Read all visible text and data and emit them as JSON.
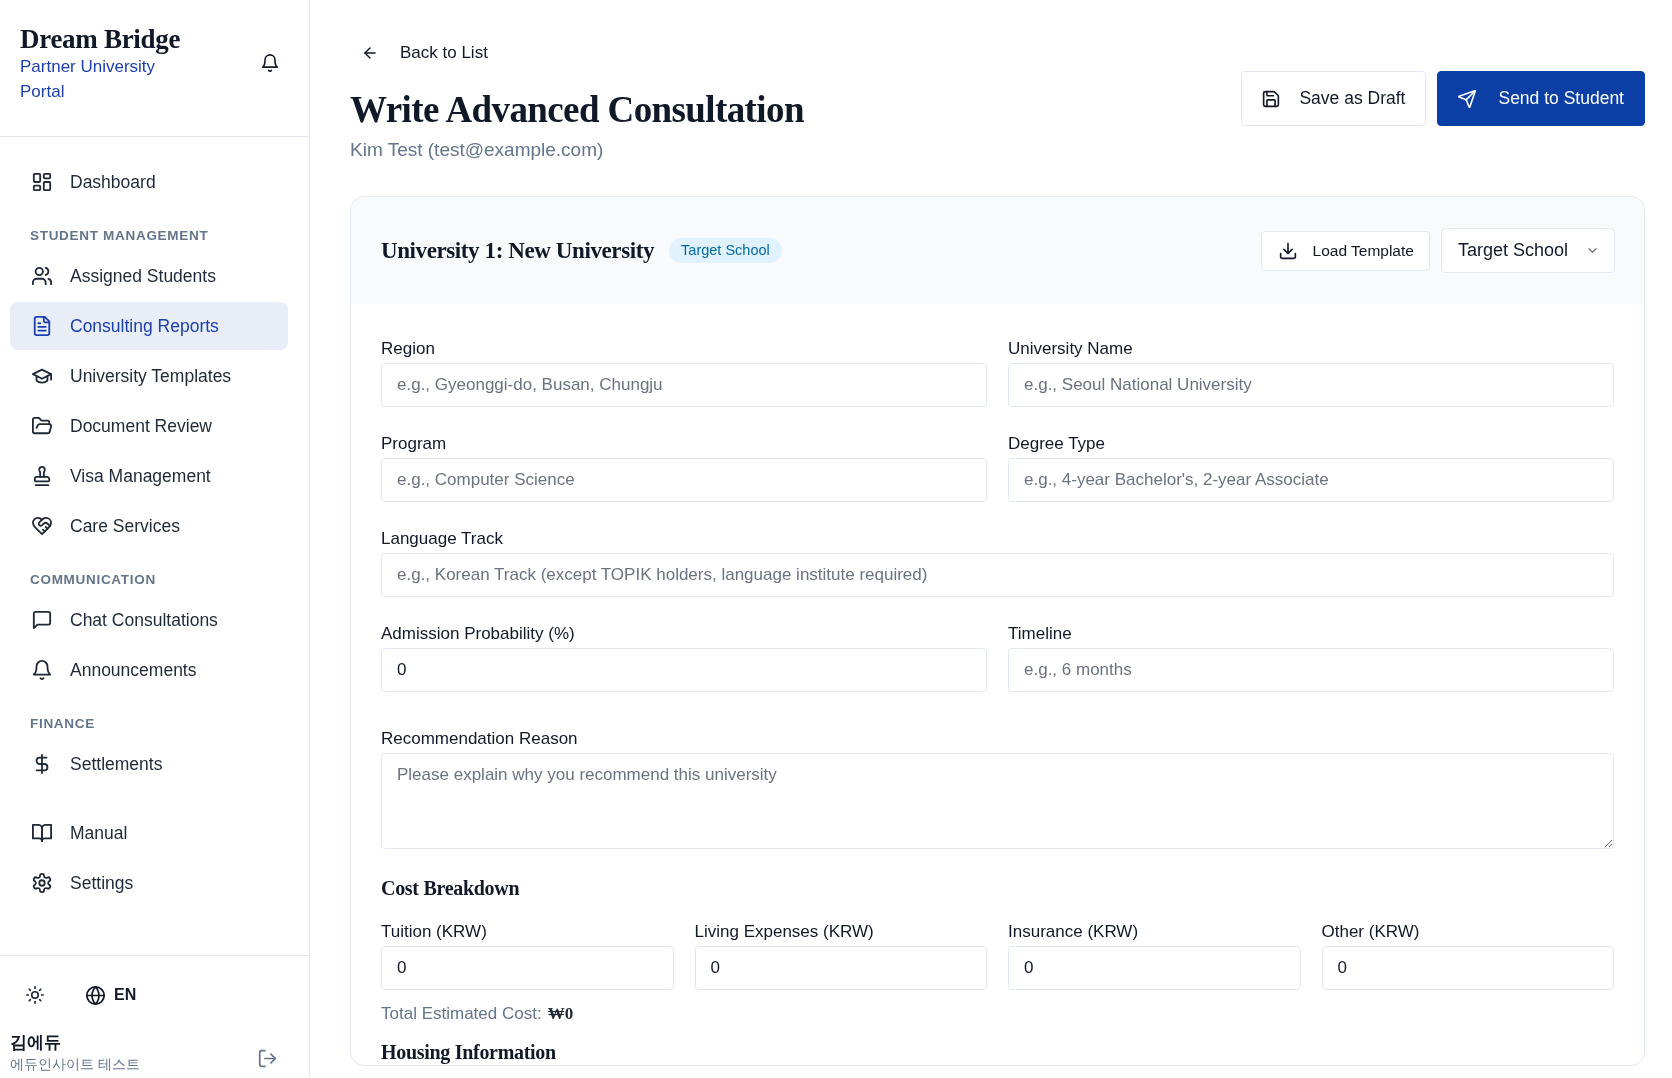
{
  "sidebar": {
    "brand": {
      "title": "Dream Bridge",
      "subtitle": "Partner University Portal"
    },
    "sections": [
      {
        "items": [
          {
            "label": "Dashboard",
            "selected": false
          }
        ]
      },
      {
        "heading": "STUDENT MANAGEMENT",
        "items": [
          {
            "label": "Assigned Students",
            "selected": false
          },
          {
            "label": "Consulting Reports",
            "selected": true
          },
          {
            "label": "University Templates",
            "selected": false
          },
          {
            "label": "Document Review",
            "selected": false
          },
          {
            "label": "Visa Management",
            "selected": false
          },
          {
            "label": "Care Services",
            "selected": false
          }
        ]
      },
      {
        "heading": "COMMUNICATION",
        "items": [
          {
            "label": "Chat Consultations",
            "selected": false
          },
          {
            "label": "Announcements",
            "selected": false
          }
        ]
      },
      {
        "heading": "FINANCE",
        "items": [
          {
            "label": "Settlements",
            "selected": false
          }
        ]
      },
      {
        "items": [
          {
            "label": "Manual",
            "selected": false
          },
          {
            "label": "Settings",
            "selected": false
          }
        ]
      }
    ],
    "footer": {
      "language": "EN",
      "user": {
        "name": "김에듀",
        "organization": "에듀인사이트 테스트"
      }
    }
  },
  "header": {
    "back_link": "Back to List",
    "title": "Write Advanced Consultation",
    "subtitle": "Kim Test (test@example.com)",
    "actions": [
      {
        "label": "Save as Draft",
        "kind": "secondary"
      },
      {
        "label": "Send to Student",
        "kind": "primary"
      }
    ]
  },
  "university_card": {
    "title": "University 1: New University",
    "badge": "Target School",
    "load_template": "Load Template",
    "school_type": {
      "value": "Target School"
    },
    "rows": [
      {
        "fields": [
          {
            "kind": "input",
            "label": "Region",
            "placeholder": "e.g., Gyeonggi-do, Busan, Chungju"
          },
          {
            "kind": "input",
            "label": "University Name",
            "placeholder": "e.g., Seoul National University"
          }
        ]
      },
      {
        "fields": [
          {
            "kind": "input",
            "label": "Program",
            "placeholder": "e.g., Computer Science"
          },
          {
            "kind": "input",
            "label": "Degree Type",
            "placeholder": "e.g., 4-year Bachelor's, 2-year Associate"
          }
        ]
      },
      {
        "fields": [
          {
            "kind": "input",
            "label": "Language Track",
            "placeholder": "e.g., Korean Track (except TOPIK holders, language institute required)"
          }
        ]
      },
      {
        "fields": [
          {
            "kind": "input",
            "label": "Admission Probability (%)",
            "value": "0"
          },
          {
            "kind": "input",
            "label": "Timeline",
            "placeholder": "e.g., 6 months"
          }
        ]
      },
      {
        "fields": [
          {
            "kind": "textarea",
            "label": "Recommendation Reason",
            "placeholder": "Please explain why you recommend this university"
          }
        ]
      }
    ],
    "cost_breakdown": {
      "heading": "Cost Breakdown",
      "fields": [
        {
          "label": "Tuition (KRW)",
          "value": "0"
        },
        {
          "label": "Living Expenses (KRW)",
          "value": "0"
        },
        {
          "label": "Insurance (KRW)",
          "value": "0"
        },
        {
          "label": "Other (KRW)",
          "value": "0"
        }
      ],
      "total_label": "Total Estimated Cost:",
      "total_value": "₩0"
    },
    "next_section_heading": "Housing Information"
  }
}
